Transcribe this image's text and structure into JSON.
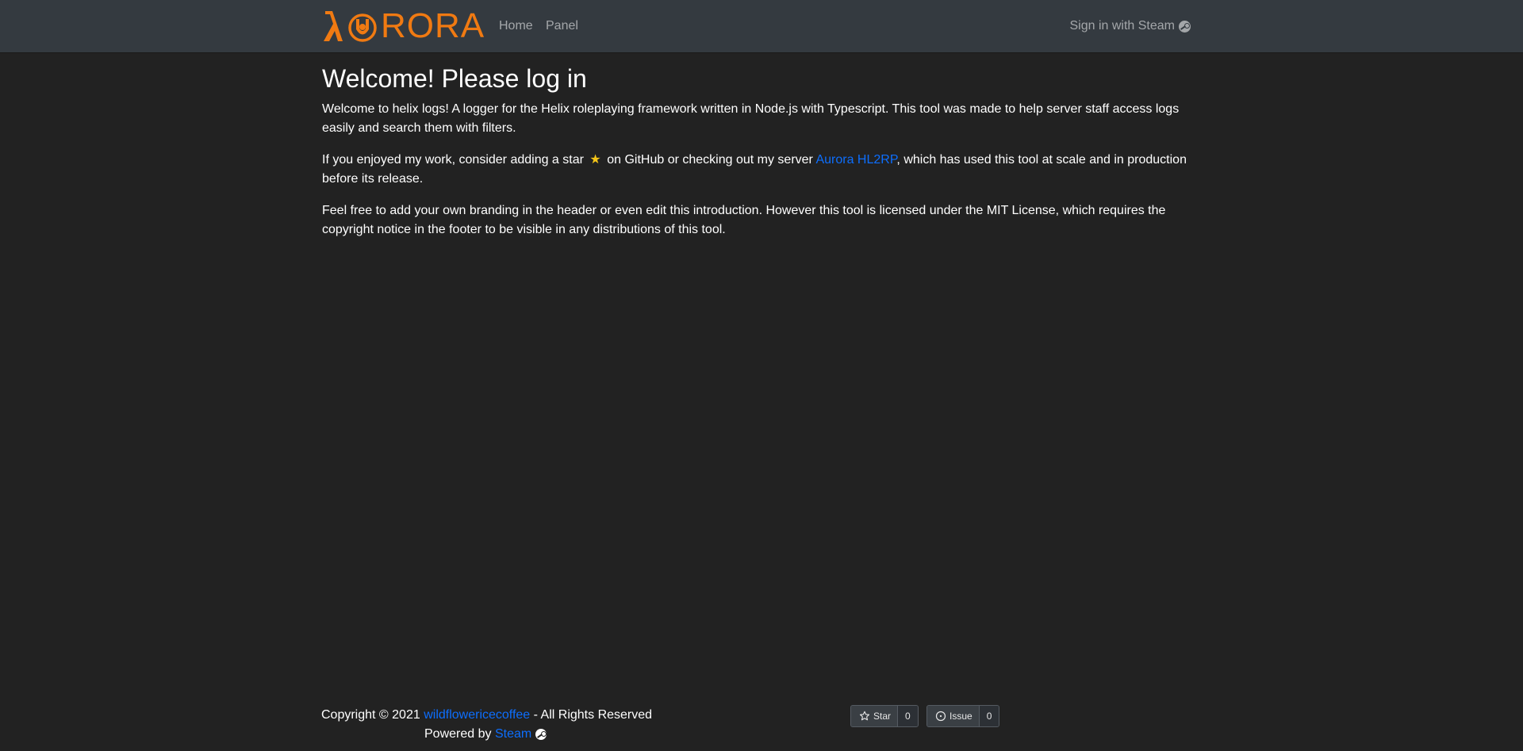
{
  "brand": {
    "logo_text": "RORA",
    "name": "AURORA",
    "color": "#f07a12"
  },
  "nav": {
    "items": [
      {
        "label": "Home"
      },
      {
        "label": "Panel"
      }
    ],
    "signin_label": "Sign in with Steam",
    "signin_icon": "steam-icon"
  },
  "main": {
    "title": "Welcome! Please log in",
    "p1": "Welcome to helix logs! A logger for the Helix roleplaying framework written in Node.js with Typescript. This tool was made to help server staff access logs easily and search them with filters.",
    "p2_before": "If you enjoyed my work, consider adding a star",
    "p2_star": "★",
    "p2_middle": "on GitHub or checking out my server",
    "p2_link": "Aurora HL2RP",
    "p2_after": ", which has used this tool at scale and in production before its release.",
    "p3": "Feel free to add your own branding in the header or even edit this introduction. However this tool is licensed under the MIT License, which requires the copyright notice in the footer to be visible in any distributions of this tool."
  },
  "footer": {
    "copyright_prefix": "Copyright © 2021",
    "author_link": "wildflowericecoffee",
    "copyright_suffix": "- All Rights Reserved",
    "powered_prefix": "Powered by",
    "powered_link": "Steam",
    "github": {
      "star_label": "Star",
      "star_count": "0",
      "issue_label": "Issue",
      "issue_count": "0"
    }
  },
  "colors": {
    "background": "#222222",
    "navbar": "#343a40",
    "link": "#0d6efd",
    "brand": "#f07a12",
    "star": "#f5c518"
  }
}
